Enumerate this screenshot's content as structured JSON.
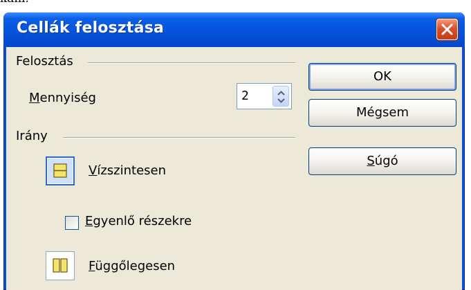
{
  "background_fragment": "kam.",
  "window": {
    "title": "Cellák felosztása",
    "close_icon": "close-x-icon"
  },
  "split_group": {
    "label": "Felosztás",
    "quantity_label_prefix": "",
    "quantity_label_accel": "M",
    "quantity_label_rest": "ennyiség",
    "quantity_value": "2"
  },
  "direction_group": {
    "label": "Irány",
    "horizontal_accel": "V",
    "horizontal_rest": "ízszintesen",
    "equal_accel": "E",
    "equal_rest": "gyenlő részekre",
    "equal_checked": false,
    "vertical_accel": "F",
    "vertical_rest": "üggőlegesen",
    "selected": "horizontal"
  },
  "buttons": {
    "ok": "OK",
    "cancel": "Mégsem",
    "help_accel": "S",
    "help_rest": "úgó"
  },
  "colors": {
    "titlebar": "#0553dd",
    "dialog_bg": "#ece9d8",
    "icon_yellow": "#f5e46a",
    "selected_border": "#316ac5"
  }
}
